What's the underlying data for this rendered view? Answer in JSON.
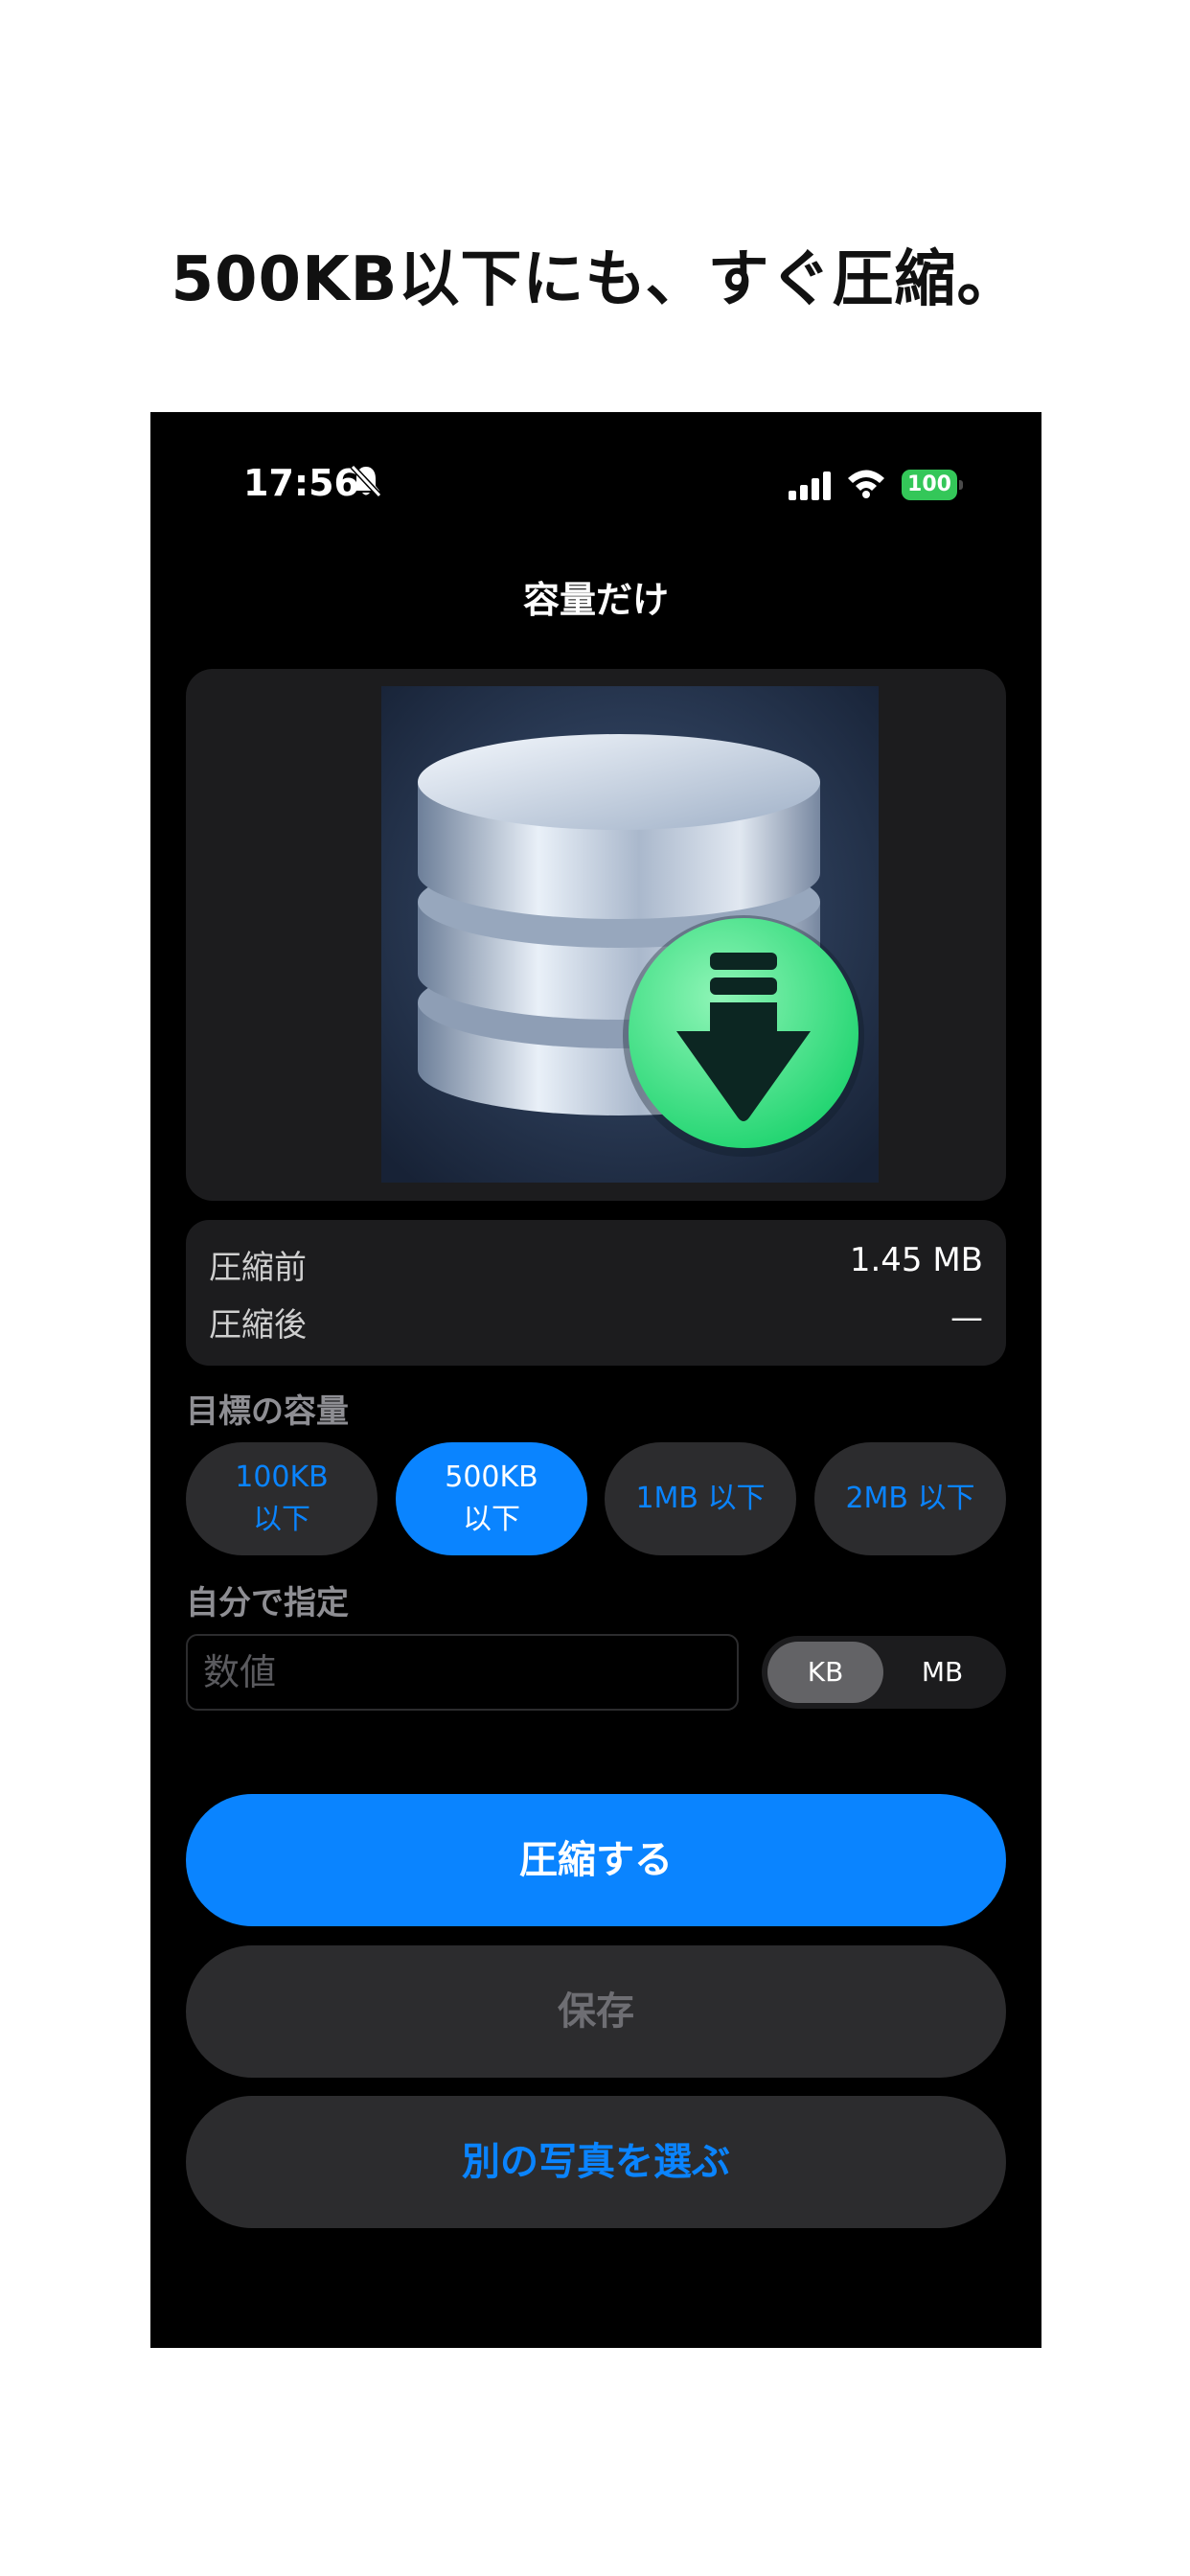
{
  "headline": "500KB以下にも、すぐ圧縮。",
  "status_bar": {
    "time": "17:56",
    "battery": "100",
    "icons": [
      "bell-slash-icon",
      "cellular-signal-icon",
      "wifi-icon",
      "battery-icon"
    ]
  },
  "nav": {
    "title": "容量だけ"
  },
  "image": {
    "icon": "database-download-icon"
  },
  "info": {
    "before_label": "圧縮前",
    "before_value": "1.45 MB",
    "after_label": "圧縮後",
    "after_value": "—"
  },
  "target": {
    "label": "目標の容量",
    "options": [
      {
        "label": "100KB\n以下",
        "selected": false
      },
      {
        "label": "500KB\n以下",
        "selected": true
      },
      {
        "label": "1MB 以下",
        "selected": false
      },
      {
        "label": "2MB 以下",
        "selected": false
      }
    ]
  },
  "custom": {
    "label": "自分で指定",
    "placeholder": "数値",
    "value": "",
    "units": [
      "KB",
      "MB"
    ],
    "selected_unit": "KB"
  },
  "actions": {
    "compress": "圧縮する",
    "save": "保存",
    "choose_other": "別の写真を選ぶ"
  },
  "colors": {
    "accent": "#0a84ff",
    "background": "#000000",
    "card": "#1c1c1e",
    "button_secondary": "#2c2c2e",
    "battery_green": "#34c759"
  }
}
